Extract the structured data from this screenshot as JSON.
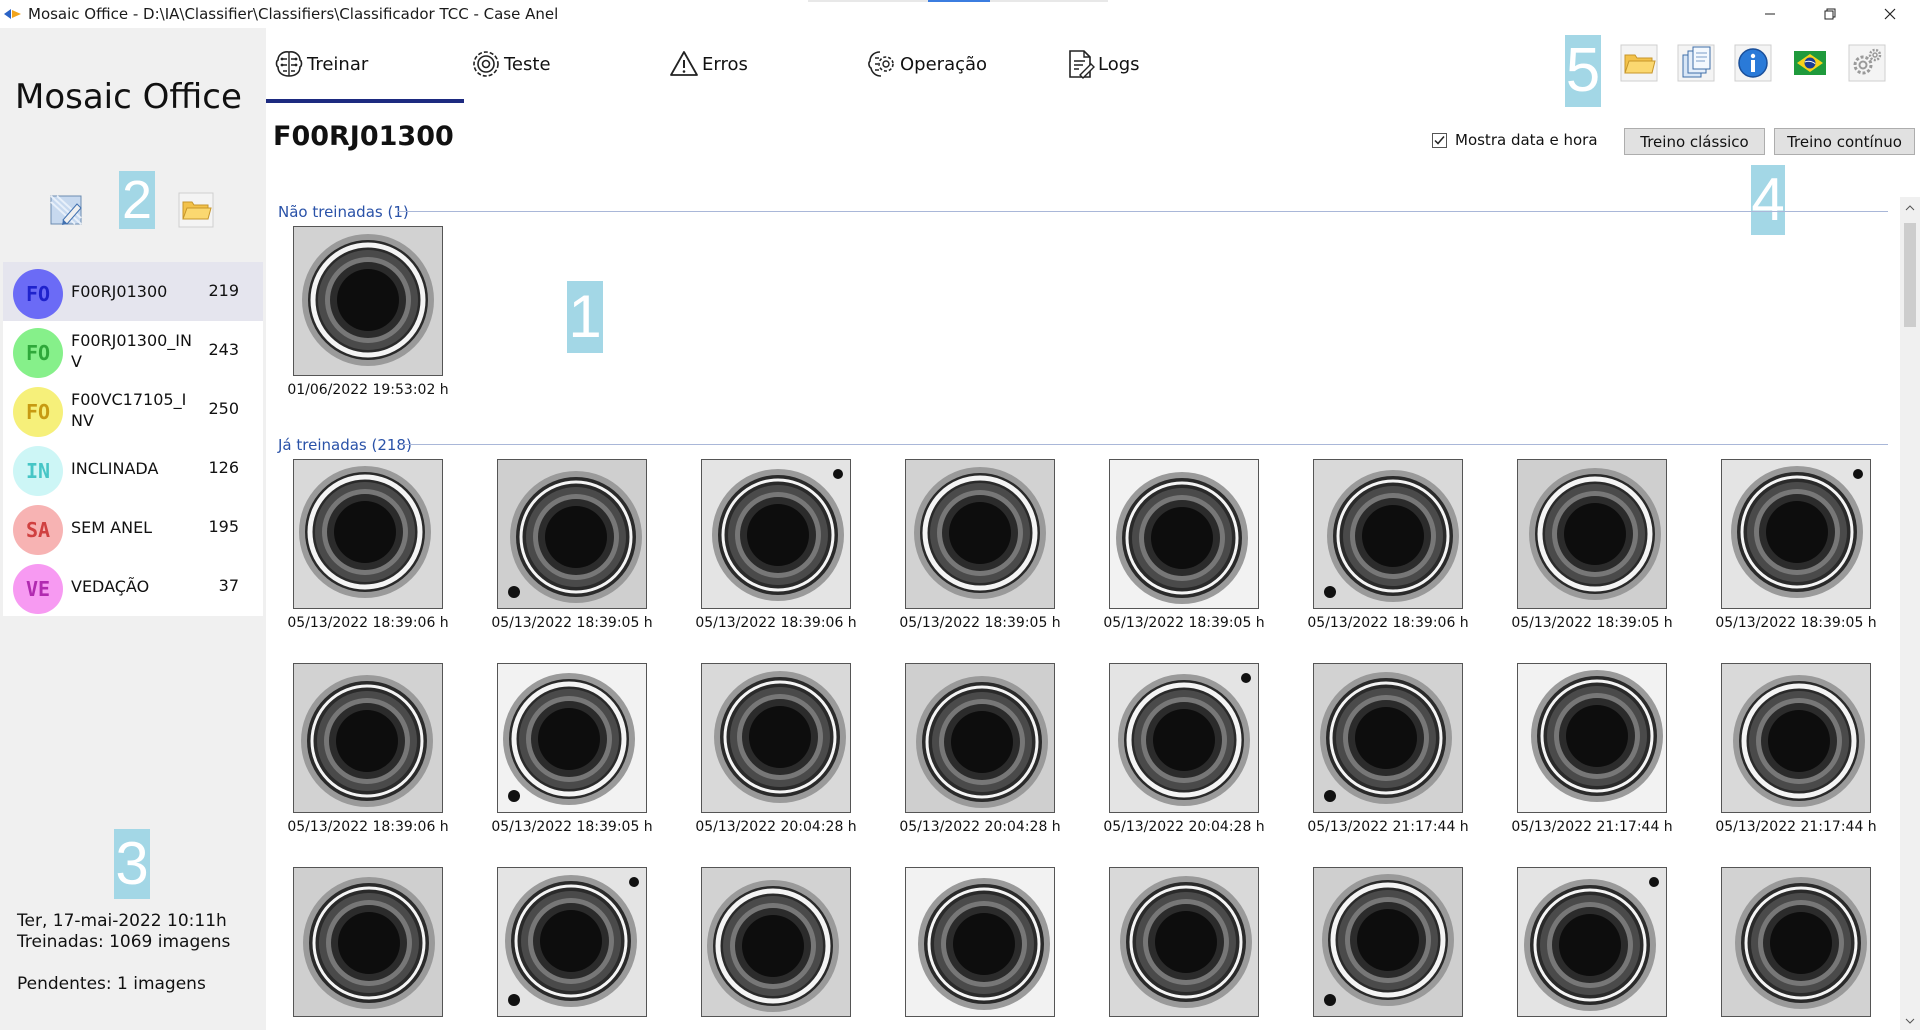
{
  "window": {
    "title": "Mosaic Office - D:\\IA\\Classifier\\Classifiers\\Classificador TCC - Case Anel",
    "controls": [
      "minimize-icon",
      "restore-icon",
      "close-icon"
    ]
  },
  "sidebar": {
    "brand": "Mosaic Office",
    "tools": [
      "edit-picture-icon",
      "folder-open-icon"
    ],
    "classes": [
      {
        "abbr": "FO",
        "name": "F00RJ01300",
        "count": "219",
        "color": "#6b6bf6",
        "text_color": "#1e22cc",
        "selected": true
      },
      {
        "abbr": "FO",
        "name": "F00RJ01300_INV",
        "count": "243",
        "color": "#86f08a",
        "text_color": "#2fa83a",
        "selected": false
      },
      {
        "abbr": "FO",
        "name": "F00VC17105_INV",
        "count": "250",
        "color": "#f6f07a",
        "text_color": "#c79a12",
        "selected": false
      },
      {
        "abbr": "IN",
        "name": "INCLINADA",
        "count": "126",
        "color": "#cdf6f6",
        "text_color": "#46c6c6",
        "selected": false
      },
      {
        "abbr": "SA",
        "name": "SEM ANEL",
        "count": "195",
        "color": "#f7b3b3",
        "text_color": "#d04040",
        "selected": false
      },
      {
        "abbr": "VE",
        "name": "VEDAÇÃO",
        "count": "37",
        "color": "#f79af2",
        "text_color": "#b12ab0",
        "selected": false
      }
    ],
    "status": {
      "date": "Ter, 17-mai-2022 10:11h",
      "trained": "Treinadas: 1069 imagens",
      "pending": "Pendentes: 1 imagens"
    }
  },
  "tabs": [
    {
      "label": "Treinar",
      "icon": "brain-icon",
      "active": true
    },
    {
      "label": "Teste",
      "icon": "gear-brain-icon",
      "active": false
    },
    {
      "label": "Erros",
      "icon": "warning-icon",
      "active": false
    },
    {
      "label": "Operação",
      "icon": "circuit-brain-icon",
      "active": false
    },
    {
      "label": "Logs",
      "icon": "document-edit-icon",
      "active": false
    }
  ],
  "toolbar_icons": [
    "folder-open-icon",
    "copy-documents-icon",
    "info-icon",
    "brazil-flag-icon",
    "settings-gears-icon"
  ],
  "callouts": [
    "1",
    "2",
    "3",
    "4",
    "5"
  ],
  "main": {
    "title": "F00RJ01300",
    "show_datetime_label": "Mostra data e hora",
    "show_datetime_checked": true,
    "btn_classic": "Treino clássico",
    "btn_continuous": "Treino contínuo",
    "untrained_label": "Não treinadas (1)",
    "trained_label": "Já treinadas (218)",
    "untrained_images": [
      {
        "ts": "01/06/2022 19:53:02 h"
      }
    ],
    "trained_images": [
      {
        "ts": "05/13/2022 18:39:06 h"
      },
      {
        "ts": "05/13/2022 18:39:05 h"
      },
      {
        "ts": "05/13/2022 18:39:06 h"
      },
      {
        "ts": "05/13/2022 18:39:05 h"
      },
      {
        "ts": "05/13/2022 18:39:05 h"
      },
      {
        "ts": "05/13/2022 18:39:06 h"
      },
      {
        "ts": "05/13/2022 18:39:05 h"
      },
      {
        "ts": "05/13/2022 18:39:05 h"
      },
      {
        "ts": "05/13/2022 18:39:06 h"
      },
      {
        "ts": "05/13/2022 18:39:05 h"
      },
      {
        "ts": "05/13/2022 20:04:28 h"
      },
      {
        "ts": "05/13/2022 20:04:28 h"
      },
      {
        "ts": "05/13/2022 20:04:28 h"
      },
      {
        "ts": "05/13/2022 21:17:44 h"
      },
      {
        "ts": "05/13/2022 21:17:44 h"
      },
      {
        "ts": "05/13/2022 21:17:44 h"
      },
      {
        "ts": ""
      },
      {
        "ts": ""
      },
      {
        "ts": ""
      },
      {
        "ts": ""
      },
      {
        "ts": ""
      },
      {
        "ts": ""
      },
      {
        "ts": ""
      },
      {
        "ts": ""
      }
    ]
  }
}
